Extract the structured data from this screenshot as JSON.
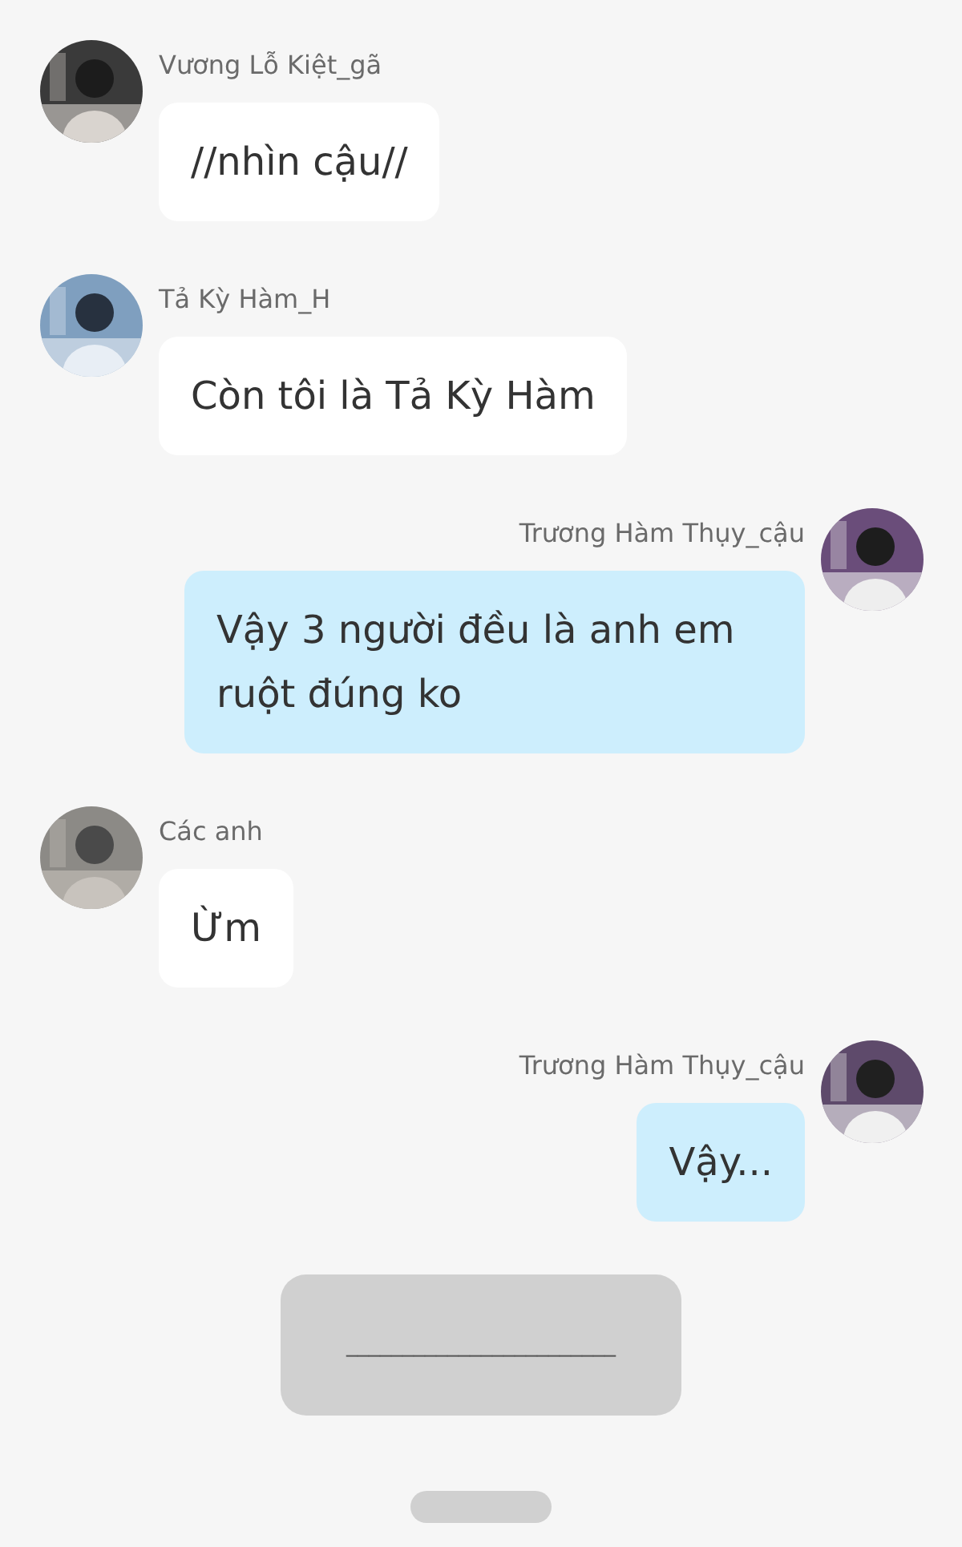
{
  "messages": [
    {
      "kind": "message",
      "outgoing": false,
      "sender": "Vương Lỗ Kiệt_gã",
      "text": "//nhìn cậu//"
    },
    {
      "kind": "message",
      "outgoing": false,
      "sender": "Tả Kỳ Hàm_H",
      "text": "Còn tôi là Tả Kỳ Hàm"
    },
    {
      "kind": "message",
      "outgoing": true,
      "sender": "Trương Hàm Thụy_cậu",
      "text": "Vậy 3 người đều là anh em ruột đúng ko"
    },
    {
      "kind": "message",
      "outgoing": false,
      "sender": "Các anh",
      "text": "Ừm"
    },
    {
      "kind": "message",
      "outgoing": true,
      "sender": "Trương Hàm Thụy_cậu",
      "text": "Vậy..."
    },
    {
      "kind": "narration",
      "text": "________________________"
    }
  ]
}
